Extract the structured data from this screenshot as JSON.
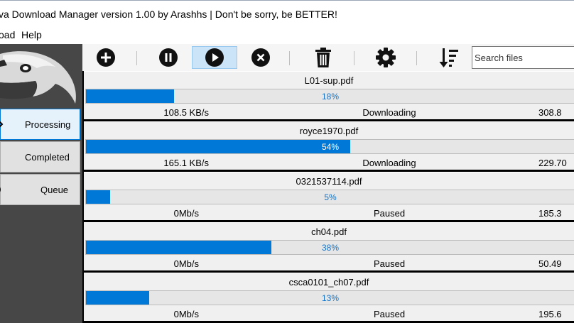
{
  "window": {
    "title": "va Download Manager version 1.00 by Arashhs | Don't be sorry, be BETTER!"
  },
  "menu": [
    "oad",
    "Help"
  ],
  "sidebar": {
    "logo_icon": "eagle-icon",
    "items": [
      {
        "label": "Processing",
        "active": true
      },
      {
        "label": "Completed",
        "active": false
      },
      {
        "label": "Queue",
        "active": false
      }
    ]
  },
  "toolbar": {
    "buttons": [
      "add-icon",
      "pause-icon",
      "play-icon",
      "cancel-icon",
      "trash-icon",
      "gear-icon",
      "sort-icon"
    ],
    "search_placeholder": "Search files"
  },
  "downloads": [
    {
      "name": "L01-sup.pdf",
      "progress": 18,
      "progress_label": "18%",
      "speed": "108.5 KB/s",
      "status": "Downloading",
      "size": "308.8"
    },
    {
      "name": "royce1970.pdf",
      "progress": 54,
      "progress_label": "54%",
      "speed": "165.1 KB/s",
      "status": "Downloading",
      "size": "229.70"
    },
    {
      "name": "0321537114.pdf",
      "progress": 5,
      "progress_label": "5%",
      "speed": "0Mb/s",
      "status": "Paused",
      "size": "185.3"
    },
    {
      "name": "ch04.pdf",
      "progress": 38,
      "progress_label": "38%",
      "speed": "0Mb/s",
      "status": "Paused",
      "size": "50.49"
    },
    {
      "name": "csca0101_ch07.pdf",
      "progress": 13,
      "progress_label": "13%",
      "speed": "0Mb/s",
      "status": "Paused",
      "size": "195.6"
    }
  ],
  "colors": {
    "accent": "#0078d7",
    "sidebar_bg": "#474747",
    "active_nav_bg": "#e5f1fb"
  }
}
